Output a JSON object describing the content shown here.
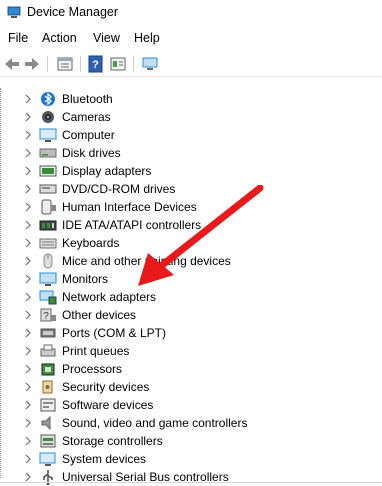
{
  "window": {
    "title": "Device Manager"
  },
  "menu": [
    "File",
    "Action",
    "View",
    "Help"
  ],
  "toolbar": {
    "buttons": [
      "back-icon",
      "forward-icon",
      "properties-icon",
      "help-icon",
      "details-icon",
      "monitor-icon"
    ]
  },
  "devices": [
    {
      "label": "Bluetooth",
      "icon": "bluetooth-icon",
      "color": "#1e73d8"
    },
    {
      "label": "Cameras",
      "icon": "camera-icon",
      "color": "#555555"
    },
    {
      "label": "Computer",
      "icon": "computer-icon",
      "color": "#2b8bd9"
    },
    {
      "label": "Disk drives",
      "icon": "disk-drive-icon",
      "color": "#6b6b6b"
    },
    {
      "label": "Display adapters",
      "icon": "display-adapter-icon",
      "color": "#3c8c3c"
    },
    {
      "label": "DVD/CD-ROM drives",
      "icon": "dvd-icon",
      "color": "#777777"
    },
    {
      "label": "Human Interface Devices",
      "icon": "hid-icon",
      "color": "#555555"
    },
    {
      "label": "IDE ATA/ATAPI controllers",
      "icon": "ide-controller-icon",
      "color": "#5a5a5a"
    },
    {
      "label": "Keyboards",
      "icon": "keyboard-icon",
      "color": "#6f6f6f"
    },
    {
      "label": "Mice and other pointing devices",
      "icon": "mouse-icon",
      "color": "#8a8a8a"
    },
    {
      "label": "Monitors",
      "icon": "monitor-icon",
      "color": "#2b8bd9"
    },
    {
      "label": "Network adapters",
      "icon": "network-adapter-icon",
      "color": "#2b8bd9"
    },
    {
      "label": "Other devices",
      "icon": "other-devices-icon",
      "color": "#666666"
    },
    {
      "label": "Ports (COM & LPT)",
      "icon": "port-icon",
      "color": "#555555"
    },
    {
      "label": "Print queues",
      "icon": "printer-icon",
      "color": "#666666"
    },
    {
      "label": "Processors",
      "icon": "processor-icon",
      "color": "#3c8c3c"
    },
    {
      "label": "Security devices",
      "icon": "security-device-icon",
      "color": "#8a6a2a"
    },
    {
      "label": "Software devices",
      "icon": "software-device-icon",
      "color": "#555555"
    },
    {
      "label": "Sound, video and game controllers",
      "icon": "speaker-icon",
      "color": "#666666"
    },
    {
      "label": "Storage controllers",
      "icon": "storage-controller-icon",
      "color": "#5a5a5a"
    },
    {
      "label": "System devices",
      "icon": "system-device-icon",
      "color": "#2b8bd9"
    },
    {
      "label": "Universal Serial Bus controllers",
      "icon": "usb-icon",
      "color": "#555555"
    }
  ],
  "annotation": {
    "color": "#e8181b"
  }
}
